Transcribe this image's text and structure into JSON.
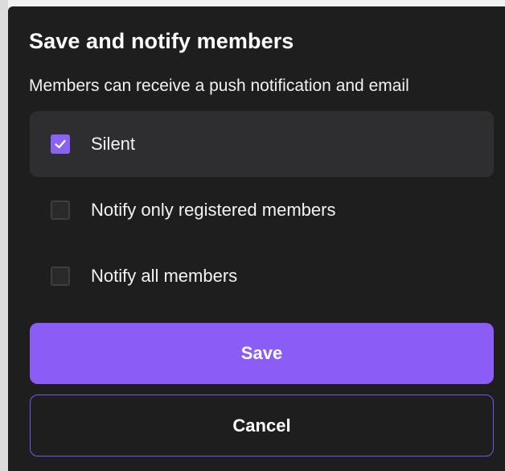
{
  "dialog": {
    "title": "Save and notify members",
    "subtitle": "Members can receive a push notification and email",
    "options": [
      {
        "label": "Silent",
        "checked": true
      },
      {
        "label": "Notify only registered members",
        "checked": false
      },
      {
        "label": "Notify all members",
        "checked": false
      }
    ],
    "save_label": "Save",
    "cancel_label": "Cancel"
  },
  "colors": {
    "background": "#1e1e1f",
    "accent": "#8b5cf6",
    "selected_row": "#2e2e30"
  },
  "icons": {
    "checkmark": "check-icon"
  }
}
